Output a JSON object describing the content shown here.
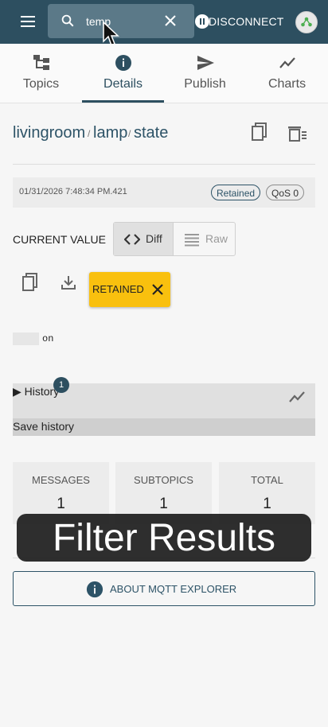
{
  "appbar": {
    "search_value": "temp",
    "disconnect_label": "DISCONNECT"
  },
  "tabs": [
    {
      "label": "Topics",
      "icon": "topics-tree-icon"
    },
    {
      "label": "Details",
      "icon": "info-icon"
    },
    {
      "label": "Publish",
      "icon": "send-icon"
    },
    {
      "label": "Charts",
      "icon": "chart-line-icon"
    }
  ],
  "active_tab": "Details",
  "breadcrumb": [
    "livingroom",
    "lamp",
    "state"
  ],
  "message": {
    "timestamp": "01/31/2026 7:48:34 PM.421",
    "retained_chip": "Retained",
    "qos_chip": "QoS 0"
  },
  "current_value": {
    "label": "CURRENT VALUE",
    "diff_label": "Diff",
    "raw_label": "Raw",
    "retained_button": "RETAINED",
    "value": "on"
  },
  "history": {
    "label": "▶ History",
    "count": "1",
    "save_label": "Save history"
  },
  "stats": [
    {
      "title": "MESSAGES",
      "value": "1"
    },
    {
      "title": "SUBTOPICS",
      "value": "1"
    },
    {
      "title": "TOTAL",
      "value": "1"
    }
  ],
  "about_label": "ABOUT MQTT EXPLORER",
  "overlay_text": "Filter Results",
  "colors": {
    "appbar": "#2d4f60",
    "accent": "#2d5367",
    "retained_button": "#f9c00e"
  }
}
